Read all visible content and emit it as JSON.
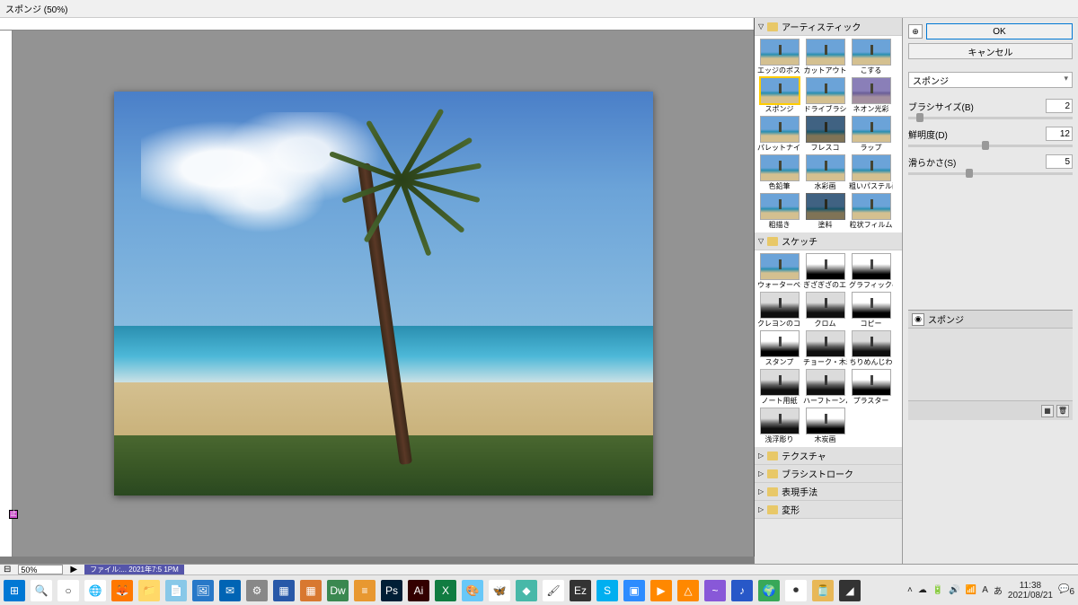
{
  "title": "スポンジ (50%)",
  "zoom": "50%",
  "status_file": "ファイル:... 2021年7:5 1PM",
  "buttons": {
    "ok": "OK",
    "cancel": "キャンセル"
  },
  "filter_dropdown": "スポンジ",
  "sliders": [
    {
      "label": "ブラシサイズ(B)",
      "value": "2",
      "pos": 5
    },
    {
      "label": "鮮明度(D)",
      "value": "12",
      "pos": 45
    },
    {
      "label": "滑らかさ(S)",
      "value": "5",
      "pos": 35
    }
  ],
  "layers_panel_title": "スポンジ",
  "groups": {
    "artistic": {
      "title": "アーティスティック",
      "items": [
        {
          "label": "エッジのポスタリゼ",
          "cls": ""
        },
        {
          "label": "カットアウト",
          "cls": ""
        },
        {
          "label": "こする",
          "cls": ""
        },
        {
          "label": "スポンジ",
          "cls": "",
          "selected": true
        },
        {
          "label": "ドライブラシ",
          "cls": ""
        },
        {
          "label": "ネオン光彩",
          "cls": "purple"
        },
        {
          "label": "パレットナイフ",
          "cls": ""
        },
        {
          "label": "フレスコ",
          "cls": "dark"
        },
        {
          "label": "ラップ",
          "cls": ""
        },
        {
          "label": "色鉛筆",
          "cls": ""
        },
        {
          "label": "水彩画",
          "cls": ""
        },
        {
          "label": "粗いパステル画",
          "cls": ""
        },
        {
          "label": "粗描き",
          "cls": ""
        },
        {
          "label": "塗料",
          "cls": "dark"
        },
        {
          "label": "粒状フィルム",
          "cls": ""
        }
      ]
    },
    "sketch": {
      "title": "スケッチ",
      "items": [
        {
          "label": "ウォーターペーパー",
          "cls": ""
        },
        {
          "label": "ぎざぎざのエッジ",
          "cls": "bw"
        },
        {
          "label": "グラフィックペン",
          "cls": "bw"
        },
        {
          "label": "クレヨンのコンテ画",
          "cls": "bw2"
        },
        {
          "label": "クロム",
          "cls": "bw2"
        },
        {
          "label": "コピー",
          "cls": "bw"
        },
        {
          "label": "スタンプ",
          "cls": "bw"
        },
        {
          "label": "チョーク・木炭画",
          "cls": "bw2"
        },
        {
          "label": "ちりめんじわ",
          "cls": "bw2"
        },
        {
          "label": "ノート用紙",
          "cls": "bw2"
        },
        {
          "label": "ハーフトーンパターン",
          "cls": "bw2"
        },
        {
          "label": "プラスター",
          "cls": "bw"
        },
        {
          "label": "浅浮彫り",
          "cls": "bw2"
        },
        {
          "label": "木炭画",
          "cls": "bw"
        }
      ]
    },
    "collapsed": [
      "テクスチャ",
      "ブラシストローク",
      "表現手法",
      "変形"
    ]
  },
  "taskbar_icons": [
    {
      "name": "start",
      "bg": "#0078d4",
      "glyph": "⊞"
    },
    {
      "name": "search",
      "bg": "#fff",
      "glyph": "🔍"
    },
    {
      "name": "cortana",
      "bg": "#fff",
      "glyph": "○"
    },
    {
      "name": "chrome",
      "bg": "#fff",
      "glyph": "🌐"
    },
    {
      "name": "firefox",
      "bg": "#ff7800",
      "glyph": "🦊"
    },
    {
      "name": "explorer",
      "bg": "#ffd868",
      "glyph": "📁"
    },
    {
      "name": "notepad",
      "bg": "#88c8e8",
      "glyph": "📄"
    },
    {
      "name": "photos",
      "bg": "#2878c8",
      "glyph": "🖼"
    },
    {
      "name": "outlook",
      "bg": "#0064b4",
      "glyph": "✉"
    },
    {
      "name": "settings",
      "bg": "#888",
      "glyph": "⚙"
    },
    {
      "name": "ide1",
      "bg": "#2858a8",
      "glyph": "▦"
    },
    {
      "name": "ide2",
      "bg": "#d87830",
      "glyph": "▦"
    },
    {
      "name": "dreamweaver",
      "bg": "#3a8850",
      "glyph": "Dw"
    },
    {
      "name": "sublime",
      "bg": "#e89830",
      "glyph": "≡"
    },
    {
      "name": "photoshop",
      "bg": "#001e36",
      "glyph": "Ps"
    },
    {
      "name": "illustrator",
      "bg": "#330000",
      "glyph": "Ai"
    },
    {
      "name": "excel",
      "bg": "#107c41",
      "glyph": "X"
    },
    {
      "name": "paint",
      "bg": "#68c8f8",
      "glyph": "🎨"
    },
    {
      "name": "butterfly",
      "bg": "#fff",
      "glyph": "🦋"
    },
    {
      "name": "app-teal",
      "bg": "#48b8a8",
      "glyph": "◆"
    },
    {
      "name": "brush",
      "bg": "#fff",
      "glyph": "🖌"
    },
    {
      "name": "ez",
      "bg": "#333",
      "glyph": "Ez"
    },
    {
      "name": "skype",
      "bg": "#00aff0",
      "glyph": "S"
    },
    {
      "name": "zoom",
      "bg": "#2d8cff",
      "glyph": "▣"
    },
    {
      "name": "media",
      "bg": "#ff8800",
      "glyph": "▶"
    },
    {
      "name": "vlc",
      "bg": "#ff8800",
      "glyph": "△"
    },
    {
      "name": "app-purple",
      "bg": "#8858d8",
      "glyph": "~"
    },
    {
      "name": "music",
      "bg": "#2858c8",
      "glyph": "♪"
    },
    {
      "name": "globe",
      "bg": "#38a858",
      "glyph": "🌍"
    },
    {
      "name": "record",
      "bg": "#fff",
      "glyph": "⏺"
    },
    {
      "name": "jar",
      "bg": "#e8b858",
      "glyph": "🫙"
    },
    {
      "name": "app-dark",
      "bg": "#333",
      "glyph": "◢"
    }
  ],
  "tray": {
    "time": "11:38",
    "date": "2021/08/21",
    "notifications": "6"
  },
  "purple_marker": "止"
}
